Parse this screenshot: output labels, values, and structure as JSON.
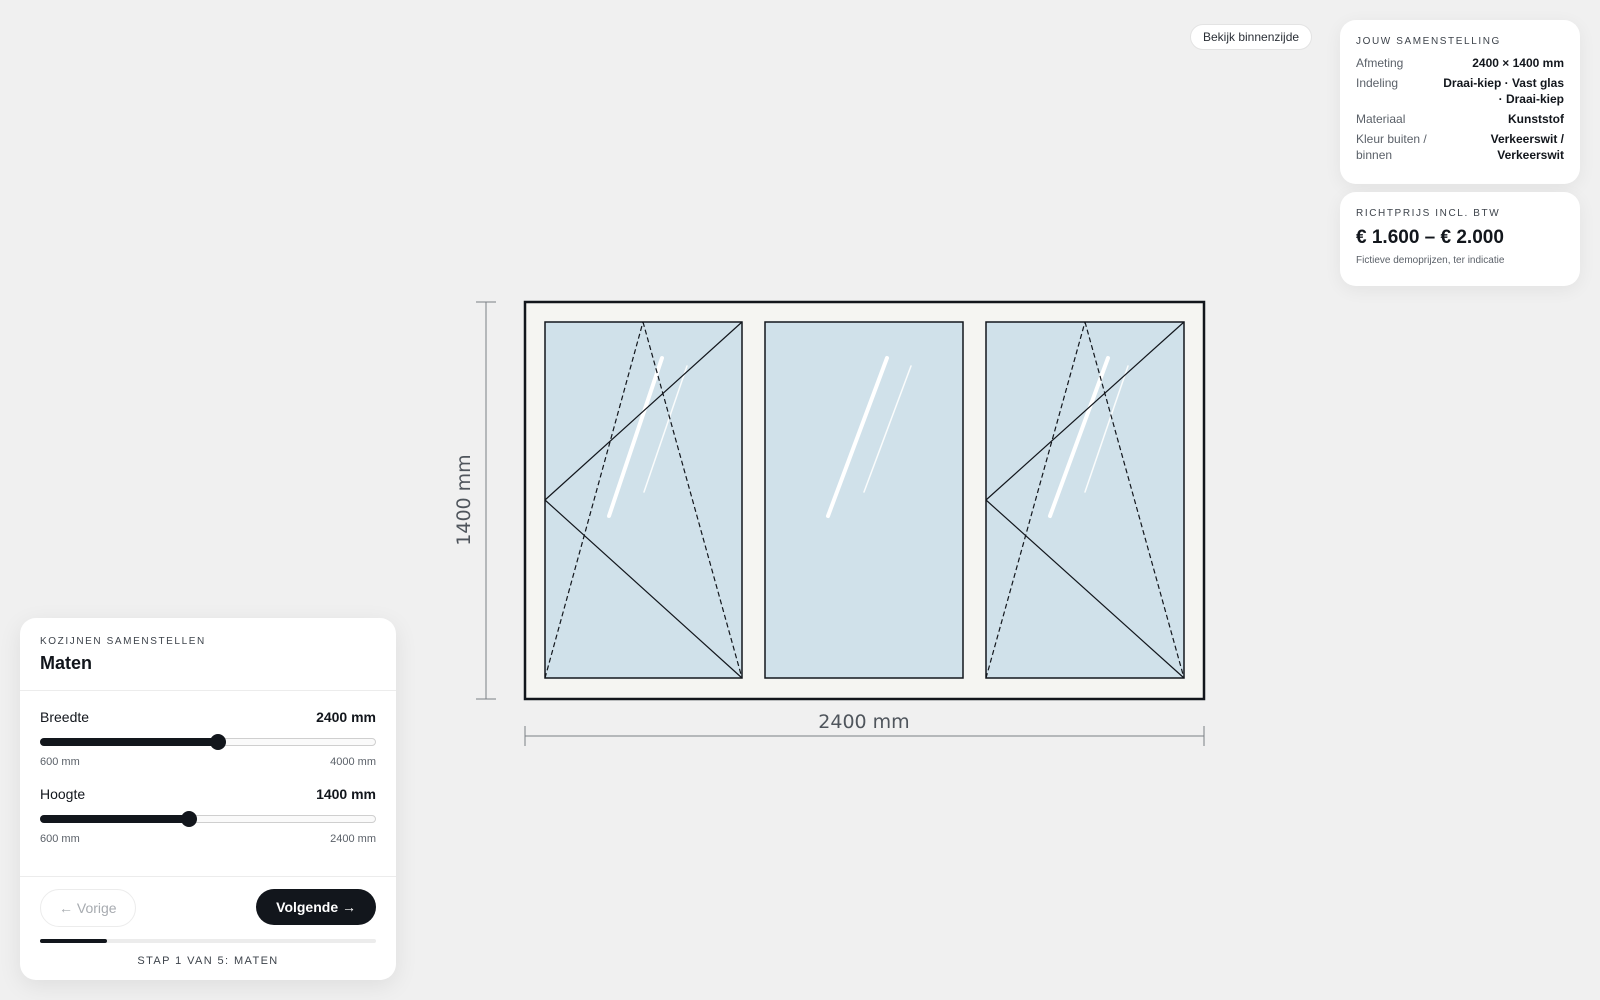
{
  "view_toggle": {
    "label": "Bekijk binnenzijde"
  },
  "summary": {
    "heading": "JOUW SAMENSTELLING",
    "rows": [
      {
        "key": "Afmeting",
        "value": "2400 × 1400 mm"
      },
      {
        "key": "Indeling",
        "value": "Draai-kiep · Vast glas · Draai-kiep"
      },
      {
        "key": "Materiaal",
        "value": "Kunststof"
      },
      {
        "key": "Kleur buiten / binnen",
        "value": "Verkeerswit / Verkeerswit"
      }
    ]
  },
  "price": {
    "heading": "RICHTPRIJS INCL. BTW",
    "value": "€ 1.600 – € 2.000",
    "note": "Fictieve demoprijzen, ter indicatie"
  },
  "drawing": {
    "width_label": "2400 mm",
    "height_label": "1400 mm",
    "sashes": [
      "draai-kiep",
      "vast glas",
      "draai-kiep"
    ]
  },
  "panel": {
    "eyebrow": "KOZIJNEN SAMENSTELLEN",
    "title": "Maten",
    "width": {
      "label": "Breedte",
      "value_label": "2400 mm",
      "value": 2400,
      "min": 600,
      "max": 4000,
      "min_label": "600 mm",
      "max_label": "4000 mm"
    },
    "height": {
      "label": "Hoogte",
      "value_label": "1400 mm",
      "value": 1400,
      "min": 600,
      "max": 2400,
      "min_label": "600 mm",
      "max_label": "2400 mm"
    },
    "prev_label": "← Vorige",
    "next_label": "Volgende →",
    "progress_fraction": 0.2,
    "step_label": "STAP 1 VAN 5: MATEN"
  },
  "colors": {
    "frame": "#12161c",
    "glass": "#d0e1ea",
    "frame_fill": "#f5f5f2",
    "accent": "#12161c"
  }
}
